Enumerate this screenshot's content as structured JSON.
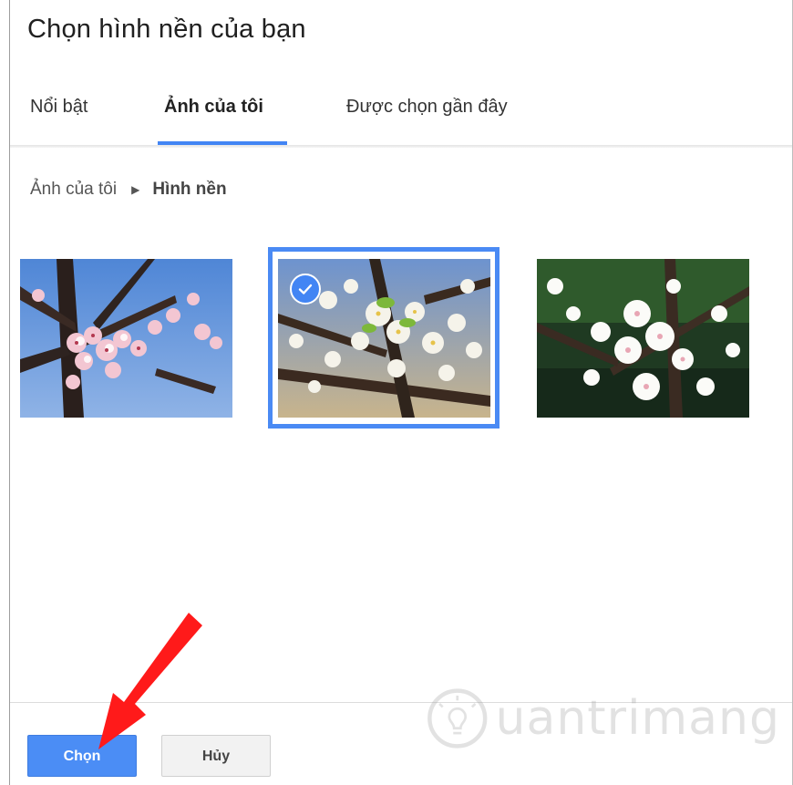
{
  "dialog": {
    "title": "Chọn hình nền của bạn"
  },
  "tabs": [
    {
      "label": "Nổi bật",
      "active": false
    },
    {
      "label": "Ảnh của tôi",
      "active": true
    },
    {
      "label": "Được chọn gần đây",
      "active": false
    }
  ],
  "breadcrumb": {
    "root": "Ảnh của tôi",
    "separator_icon": "caret-right-icon",
    "current": "Hình nền"
  },
  "wallpapers": [
    {
      "name": "cherry-blossom-pink",
      "selected": false
    },
    {
      "name": "white-blossom-green-leaves",
      "selected": true
    },
    {
      "name": "cherry-blossom-white",
      "selected": false
    }
  ],
  "buttons": {
    "choose": "Chọn",
    "cancel": "Hủy"
  },
  "watermark": {
    "text": "uantrimang",
    "icon": "lightbulb-icon"
  },
  "colors": {
    "accent": "#4285f4",
    "annotation_arrow": "#ff0000"
  }
}
